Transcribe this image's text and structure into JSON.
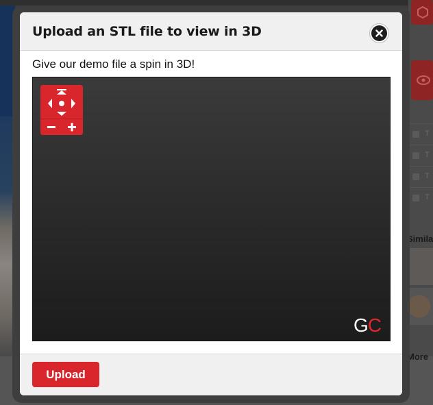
{
  "background": {
    "sidebar_rows": [
      "T",
      "T",
      "T",
      "T"
    ],
    "similar_label": "Simila",
    "more_label": "More"
  },
  "modal": {
    "title": "Upload an STL file to view in 3D",
    "subtitle": "Give our demo file a spin in 3D!",
    "viewer": {
      "logo_g": "G",
      "logo_c": "C",
      "zoom_out_label": "−",
      "zoom_in_label": "+"
    },
    "upload_label": "Upload"
  },
  "colors": {
    "accent": "#d8262c",
    "viewer_bg": "#2c2c2c",
    "header_bg": "#f0f0f0"
  },
  "icons": [
    "close-icon",
    "pan-up-icon",
    "pan-down-icon",
    "pan-left-icon",
    "pan-right-icon",
    "center-dot-icon",
    "zoom-out-icon",
    "zoom-in-icon"
  ]
}
